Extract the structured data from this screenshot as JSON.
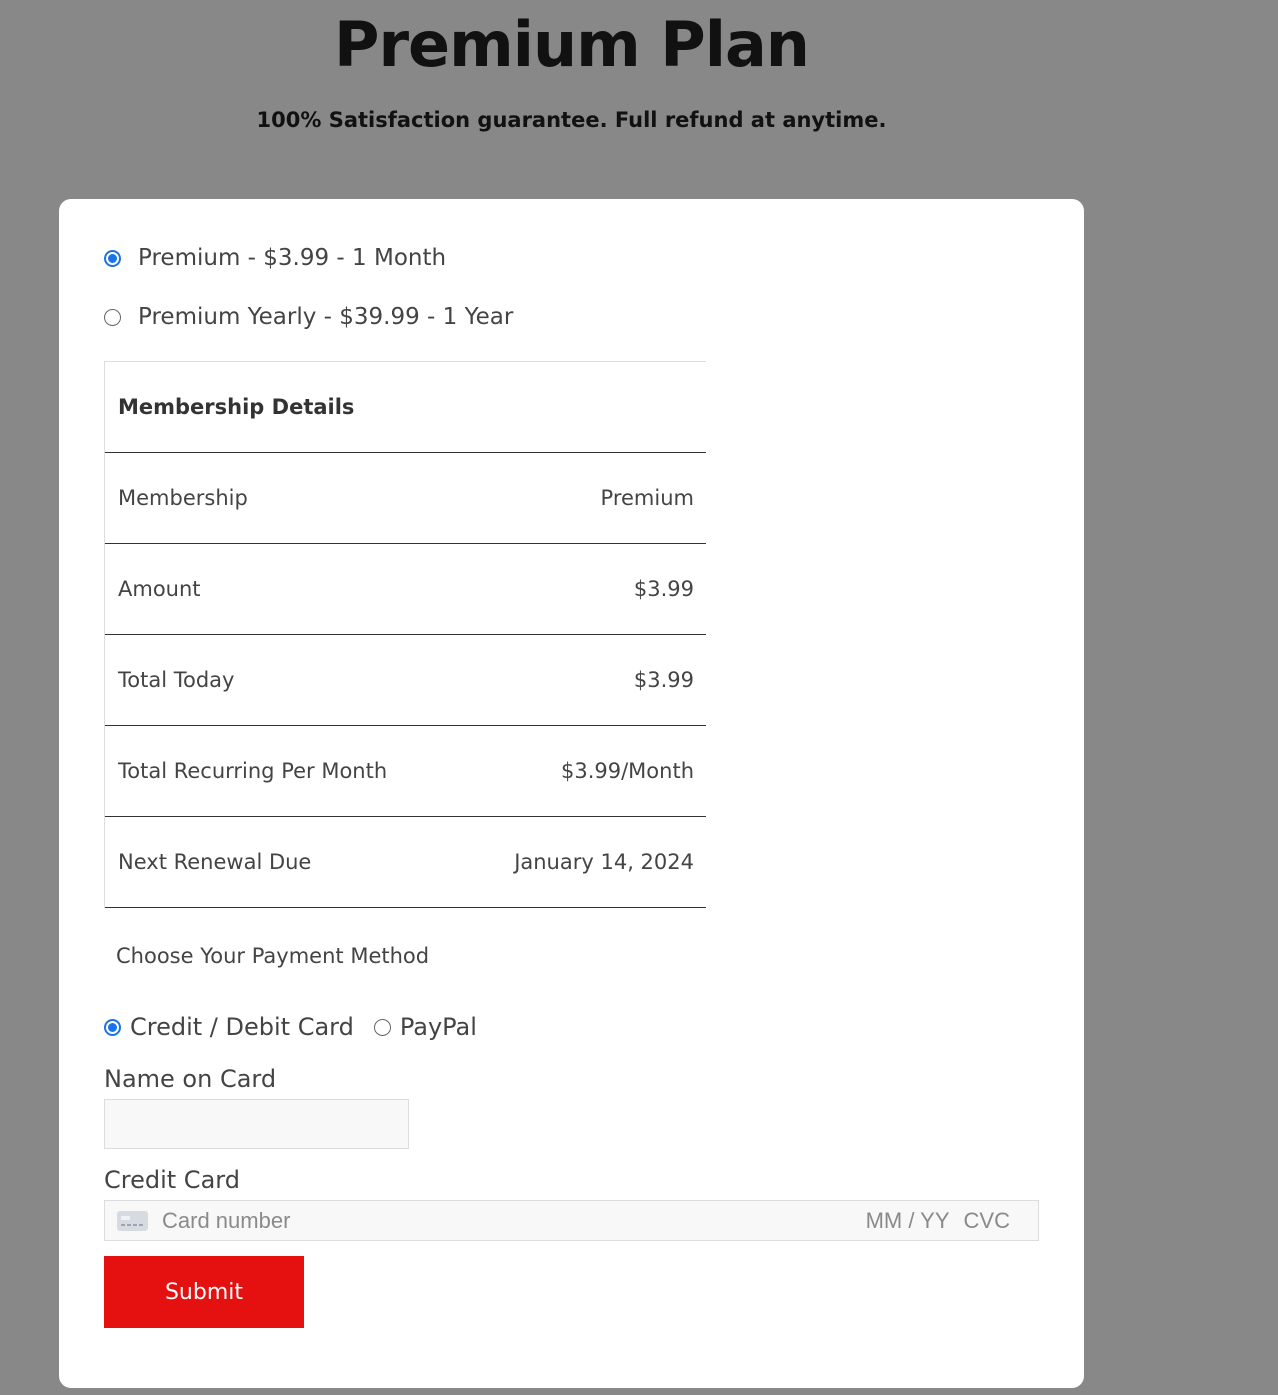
{
  "header": {
    "title": "Premium Plan",
    "subtitle": "100% Satisfaction guarantee. Full refund at anytime."
  },
  "plans": [
    {
      "label": "Premium - $3.99 -  1 Month",
      "selected": true
    },
    {
      "label": "Premium Yearly - $39.99 -  1 Year",
      "selected": false
    }
  ],
  "membership_details": {
    "heading": "Membership Details",
    "rows": [
      {
        "label": "Membership",
        "value": "Premium"
      },
      {
        "label": "Amount",
        "value": "$3.99"
      },
      {
        "label": "Total Today",
        "value": "$3.99"
      },
      {
        "label": "Total Recurring Per Month",
        "value": "$3.99/Month"
      },
      {
        "label": "Next Renewal Due",
        "value": "January 14, 2024"
      }
    ]
  },
  "payment": {
    "title": "Choose Your Payment Method",
    "methods": [
      {
        "label": "Credit / Debit Card",
        "selected": true
      },
      {
        "label": "PayPal",
        "selected": false
      }
    ],
    "name_label": "Name on Card",
    "name_value": "",
    "credit_label": "Credit Card",
    "card_number_placeholder": "Card number",
    "expiry_placeholder": "MM / YY",
    "cvc_placeholder": "CVC",
    "submit_label": "Submit"
  },
  "colors": {
    "background": "#888888",
    "accent_radio": "#1a73e8",
    "submit": "#e51111"
  }
}
